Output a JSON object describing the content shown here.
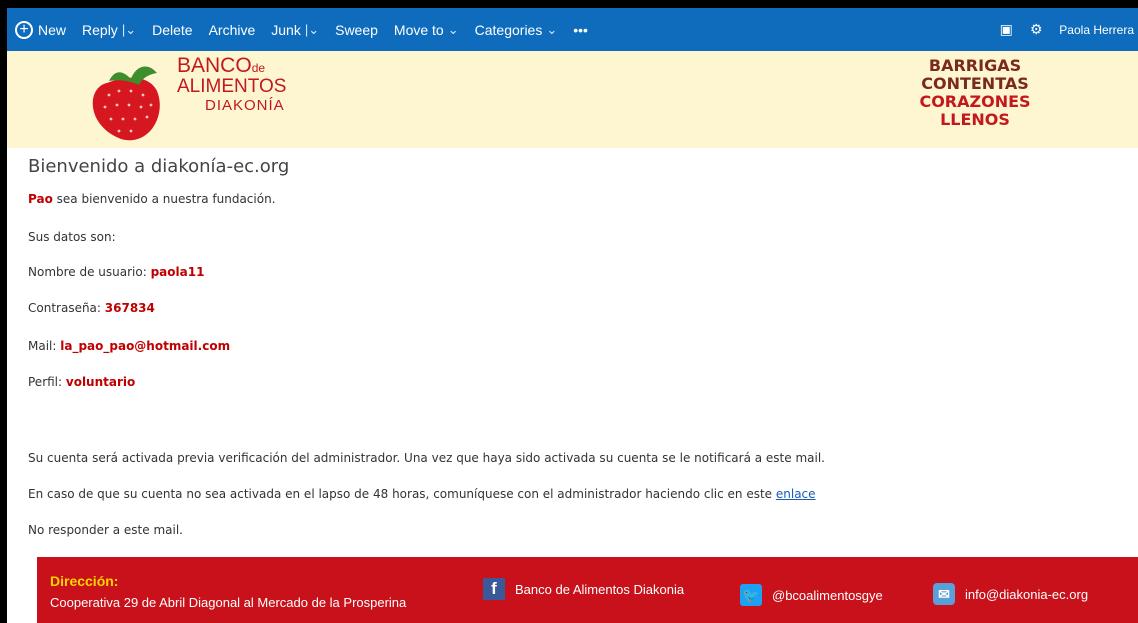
{
  "toolbar": {
    "new_label": "New",
    "reply_label": "Reply",
    "delete_label": "Delete",
    "archive_label": "Archive",
    "junk_label": "Junk",
    "sweep_label": "Sweep",
    "move_label": "Move to",
    "categories_label": "Categories",
    "more_label": "•••",
    "user_name": "Paola Herrera",
    "accent": "#0f6cbd"
  },
  "banner": {
    "logo_banco": "BANCO",
    "logo_de": "de",
    "logo_alimentos": "ALIMENTOS",
    "logo_diakonia": "DIAKONÍA",
    "right_line1": "BARRIGAS",
    "right_line2": "CONTENTAS",
    "right_line3": "CORAZONES",
    "right_line4": "LLENOS"
  },
  "email": {
    "title": "Bienvenido a diakonía-ec.org",
    "greeting_name": "Pao",
    "greeting_text": " sea bienvenido a nuestra fundación.",
    "data_intro": "Sus datos son:",
    "username_label": "Nombre de usuario: ",
    "username": "paola11",
    "password_label": "Contraseña: ",
    "password": "367834",
    "mail_label": "Mail: ",
    "mail": "la_pao_pao@hotmail.com",
    "profile_label": "Perfil: ",
    "profile": "voluntario",
    "activation_note": "Su cuenta será activada previa verificación del administrador. Una vez que haya sido activada su cuenta se le notificará a este mail.",
    "contact_note": "En caso de que su cuenta no sea activada en el lapso de 48 horas, comuníquese con el administrador haciendo clic en este ",
    "contact_link": "enlace",
    "no_reply": "No responder a este mail."
  },
  "footer": {
    "address_label": "Dirección:",
    "address": "Cooperativa 29 de Abril Diagonal al Mercado de la Prosperina",
    "facebook": "Banco de Alimentos Diakonia",
    "twitter": "@bcoalimentosgye",
    "email": "info@diakonia-ec.org",
    "bg_color": "#c8111a"
  }
}
